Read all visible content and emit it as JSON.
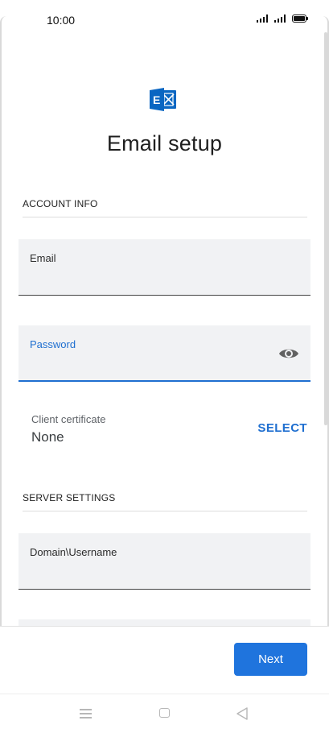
{
  "status_bar": {
    "time": "10:00"
  },
  "header": {
    "logo_icon": "exchange-logo-icon",
    "logo_color": "#0a66c2",
    "title": "Email setup"
  },
  "account_info": {
    "section_label": "ACCOUNT INFO",
    "email_label": "Email",
    "email_value": "",
    "password_label": "Password",
    "password_value": "",
    "password_toggle_icon": "eye-icon"
  },
  "client_certificate": {
    "label": "Client certificate",
    "value": "None",
    "select_label": "SELECT"
  },
  "server_settings": {
    "section_label": "SERVER SETTINGS",
    "domain_username_label": "Domain\\Username",
    "domain_username_value": ""
  },
  "footer": {
    "next_label": "Next"
  },
  "nav_bar": {
    "icons": [
      "menu-icon",
      "home-icon",
      "back-icon"
    ]
  },
  "colors": {
    "accent": "#1f74dd",
    "field_background": "#f1f2f4"
  }
}
